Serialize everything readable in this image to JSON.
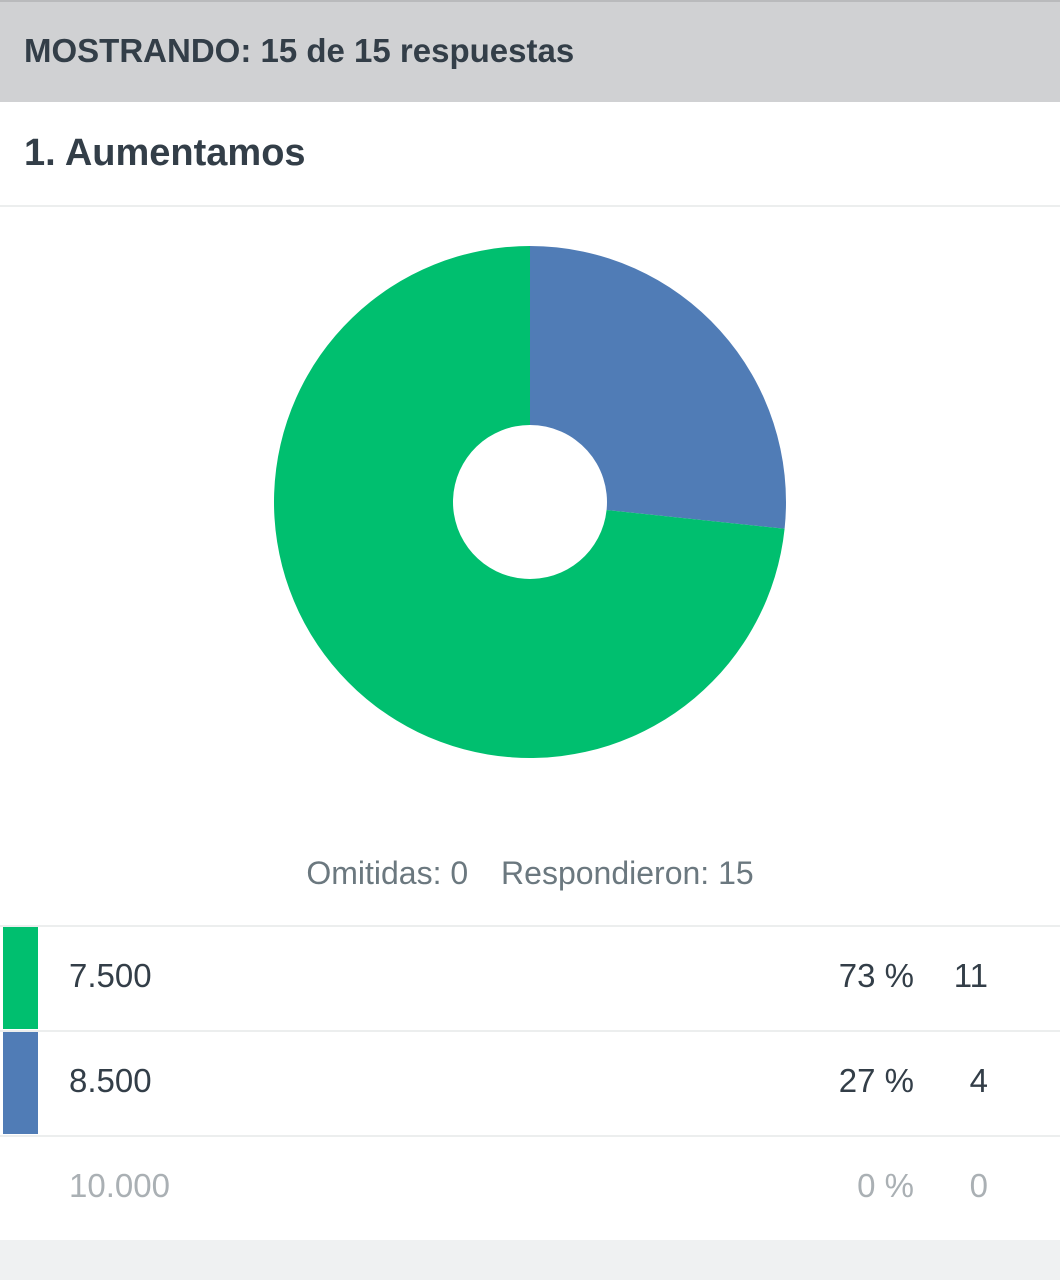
{
  "header": {
    "showing": "MOSTRANDO: 15 de 15 respuestas"
  },
  "question": {
    "title": "1. Aumentamos"
  },
  "stats": {
    "skipped": "Omitidas: 0",
    "answered": "Respondieron: 15"
  },
  "rows": [
    {
      "label": "7.500",
      "percent": "73 %",
      "count": "11",
      "color": "#00bf6f"
    },
    {
      "label": "8.500",
      "percent": "27 %",
      "count": "4",
      "color": "#507cb6"
    },
    {
      "label": "10.000",
      "percent": "0 %",
      "count": "0",
      "color": ""
    }
  ],
  "chart_data": {
    "type": "pie",
    "donut": true,
    "categories": [
      "7.500",
      "8.500",
      "10.000"
    ],
    "values": [
      11,
      4,
      0
    ],
    "colors": [
      "#00bf6f",
      "#507cb6",
      "#e0e0e0"
    ]
  }
}
